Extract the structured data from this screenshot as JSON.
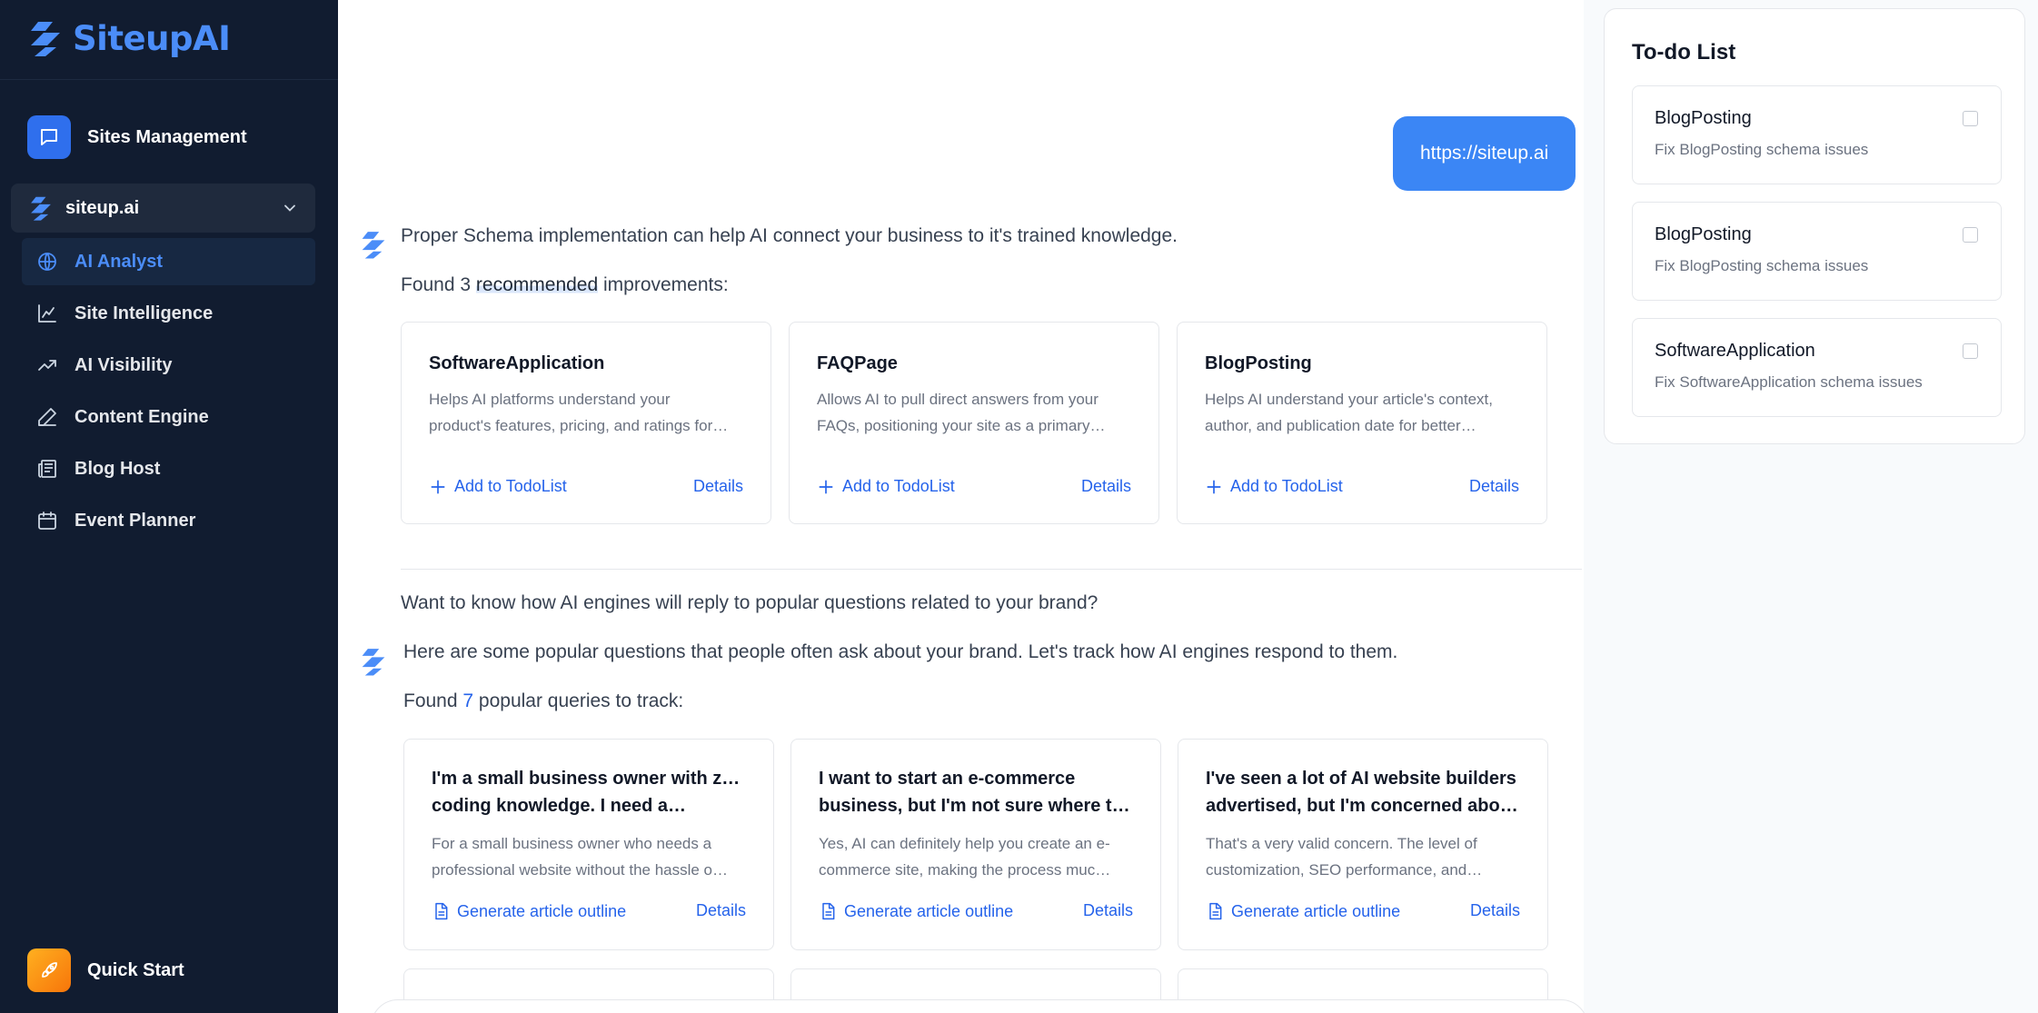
{
  "brand": {
    "name": "SiteupAI",
    "icon": "siteup-logo-icon",
    "color": "#4b8df8"
  },
  "sidebar": {
    "sites_management": {
      "label": "Sites Management",
      "icon": "message-square-icon"
    },
    "site_selector": {
      "value": "siteup.ai",
      "icon": "siteup-logo-icon"
    },
    "nav": [
      {
        "label": "AI Analyst",
        "icon": "globe-icon",
        "active": true
      },
      {
        "label": "Site Intelligence",
        "icon": "line-chart-icon",
        "active": false
      },
      {
        "label": "AI Visibility",
        "icon": "trending-up-icon",
        "active": false
      },
      {
        "label": "Content Engine",
        "icon": "pen-icon",
        "active": false
      },
      {
        "label": "Blog Host",
        "icon": "newspaper-icon",
        "active": false
      },
      {
        "label": "Event Planner",
        "icon": "calendar-icon",
        "active": false
      }
    ],
    "quick_start": {
      "label": "Quick Start",
      "icon": "rocket-icon"
    }
  },
  "chat": {
    "user_url": "https://siteup.ai",
    "schema_intro": "Proper Schema implementation can help AI connect your business to it's trained knowledge.",
    "schema_found_prefix": "Found ",
    "schema_found_count": "3",
    "schema_found_highlight": "recommended",
    "schema_found_suffix": " improvements:",
    "schema_cards": [
      {
        "title": "SoftwareApplication",
        "desc_line1": "Helps AI platforms understand your",
        "desc_line2": "product's features, pricing, and ratings for…",
        "action": "Add to TodoList",
        "details": "Details"
      },
      {
        "title": "FAQPage",
        "desc_line1": "Allows AI to pull direct answers from your",
        "desc_line2": "FAQs, positioning your site as a primary…",
        "action": "Add to TodoList",
        "details": "Details"
      },
      {
        "title": "BlogPosting",
        "desc_line1": "Helps AI understand your article's context,",
        "desc_line2": "author, and publication date for better…",
        "action": "Add to TodoList",
        "details": "Details"
      }
    ],
    "questions_prompt": "Want to know how AI engines will reply to popular questions related to your brand?",
    "questions_intro": "Here are some popular questions that people often ask about your brand. Let's track how AI engines respond to them.",
    "queries_found_prefix": "Found ",
    "queries_found_count": "7",
    "queries_found_suffix": " popular queries to track:",
    "query_cards": [
      {
        "title_line1": "I'm a small business owner with zero",
        "title_line2": "coding knowledge. I need a…",
        "desc_line1": "For a small business owner who needs a",
        "desc_line2": "professional website without the hassle o…",
        "action": "Generate article outline",
        "details": "Details"
      },
      {
        "title_line1": "I want to start an e-commerce",
        "title_line2": "business, but I'm not sure where to…",
        "desc_line1": "Yes, AI can definitely help you create an e-",
        "desc_line2": "commerce site, making the process muc…",
        "action": "Generate article outline",
        "details": "Details"
      },
      {
        "title_line1": "I've seen a lot of AI website builders",
        "title_line2": "advertised, but I'm concerned abou…",
        "desc_line1": "That's a very valid concern. The level of",
        "desc_line2": "customization, SEO performance, and…",
        "action": "Generate article outline",
        "details": "Details"
      }
    ]
  },
  "todo": {
    "title": "To-do List",
    "items": [
      {
        "title": "BlogPosting",
        "subtitle": "Fix BlogPosting schema issues",
        "checked": false
      },
      {
        "title": "BlogPosting",
        "subtitle": "Fix BlogPosting schema issues",
        "checked": false
      },
      {
        "title": "SoftwareApplication",
        "subtitle": "Fix SoftwareApplication schema issues",
        "checked": false
      }
    ]
  },
  "colors": {
    "sidebar_bg": "#111c30",
    "accent": "#3b86f5",
    "link": "#2563eb"
  }
}
